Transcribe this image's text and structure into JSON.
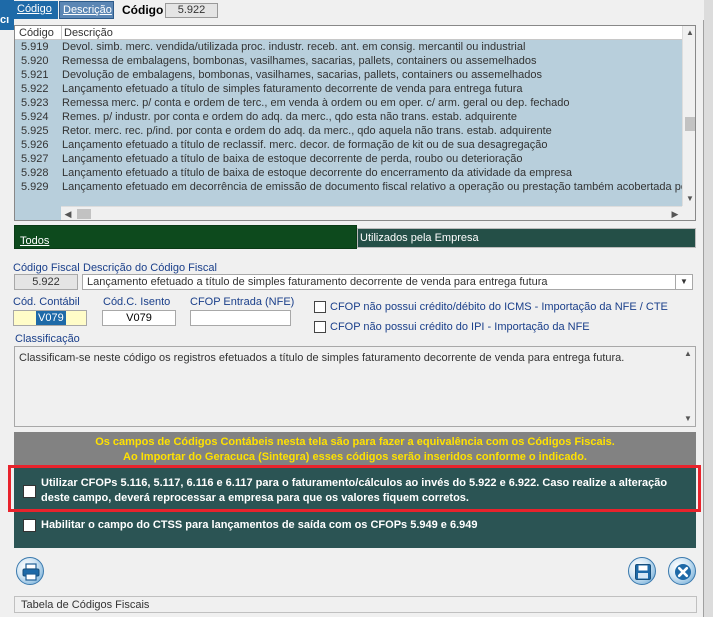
{
  "window": {
    "edge_label": "cı"
  },
  "top_tabs": {
    "codigo": "Código",
    "descricao": "Descrição"
  },
  "search": {
    "label": "Código",
    "value": "5.922"
  },
  "grid": {
    "headers": {
      "codigo": "Código",
      "descricao": "Descrição"
    },
    "rows": [
      {
        "code": "5.919",
        "desc": "Devol. simb. merc. vendida/utilizada proc. industr. receb. ant. em consig. mercantil ou industrial"
      },
      {
        "code": "5.920",
        "desc": "Remessa de embalagens, bombonas, vasilhames, sacarias, pallets, containers ou assemelhados"
      },
      {
        "code": "5.921",
        "desc": "Devolução de embalagens, bombonas, vasilhames, sacarias, pallets, containers ou assemelhados"
      },
      {
        "code": "5.922",
        "desc": "Lançamento efetuado a título de simples faturamento decorrente de venda para entrega futura"
      },
      {
        "code": "5.923",
        "desc": "Remessa merc. p/ conta e ordem de terc., em venda à ordem ou em oper. c/ arm. geral ou dep. fechado"
      },
      {
        "code": "5.924",
        "desc": "Remes. p/ industr. por conta e ordem do adq. da merc., qdo esta não trans. estab. adquirente"
      },
      {
        "code": "5.925",
        "desc": "Retor. merc. rec. p/ind. por conta e ordem do adq. da merc., qdo aquela não trans. estab. adquirente"
      },
      {
        "code": "5.926",
        "desc": "Lançamento efetuado a título de reclassif. merc. decor. de formação de kit ou de sua desagregação"
      },
      {
        "code": "5.927",
        "desc": "Lançamento efetuado a título de baixa de estoque decorrente de perda, roubo ou deterioração"
      },
      {
        "code": "5.928",
        "desc": "Lançamento efetuado a título de baixa de estoque decorrente do encerramento da atividade da empresa"
      },
      {
        "code": "5.929",
        "desc": "Lançamento efetuado em decorrência de emissão de documento fiscal relativo a operação ou prestação também acobertada por"
      }
    ]
  },
  "filters": {
    "todos": "Todos",
    "utilizados": "Utilizados pela Empresa"
  },
  "fields": {
    "codigo_fiscal_label": "Código Fiscal",
    "codigo_fiscal_value": "5.922",
    "descricao_label": "Descrição do Código Fiscal",
    "descricao_value": "Lançamento efetuado a título de simples faturamento decorrente de venda para entrega futura",
    "contabil_label": "Cód. Contábil",
    "contabil_value": "V079",
    "isento_label": "Cód.C. Isento",
    "isento_value": "V079",
    "cfop_entrada_label": "CFOP Entrada (NFE)",
    "cfop_entrada_value": "",
    "icms_checkbox_label": "CFOP não possui crédito/débito do ICMS -  Importação da NFE / CTE",
    "ipi_checkbox_label": "CFOP não possui crédito do IPI -  Importação da NFE",
    "classificacao_label": "Classificação",
    "classificacao_value": "Classificam-se neste código os registros efetuados a título de simples faturamento decorrente de venda para entrega futura."
  },
  "notice": {
    "line1": "Os campos de Códigos Contábeis nesta tela são para fazer a equivalência com os Códigos Fiscais.",
    "line2": "Ao Importar do Geracuca (Sintegra) esses códigos serão inseridos conforme o indicado."
  },
  "options": {
    "cfops_line1": "Utilizar CFOPs 5.116, 5.117, 6.116 e 6.117 para o faturamento/cálculos ao invés do 5.922 e 6.922. Caso realize a alteração",
    "cfops_line2": "deste campo, deverá reprocessar a empresa para que os valores fiquem corretos.",
    "ctss": "Habilitar o campo do CTSS para lançamentos de saída com os CFOPs 5.949 e 6.949"
  },
  "status": {
    "text": "Tabela de Códigos Fiscais"
  },
  "colors": {
    "accent": "#1e6aa8",
    "grid_bg": "#b8cfdc",
    "panel": "#2b5454",
    "notice_text": "#ffe100",
    "highlight": "#e8232c"
  },
  "icons": {
    "print": "printer-icon",
    "save": "floppy-icon",
    "close": "close-x-icon"
  }
}
